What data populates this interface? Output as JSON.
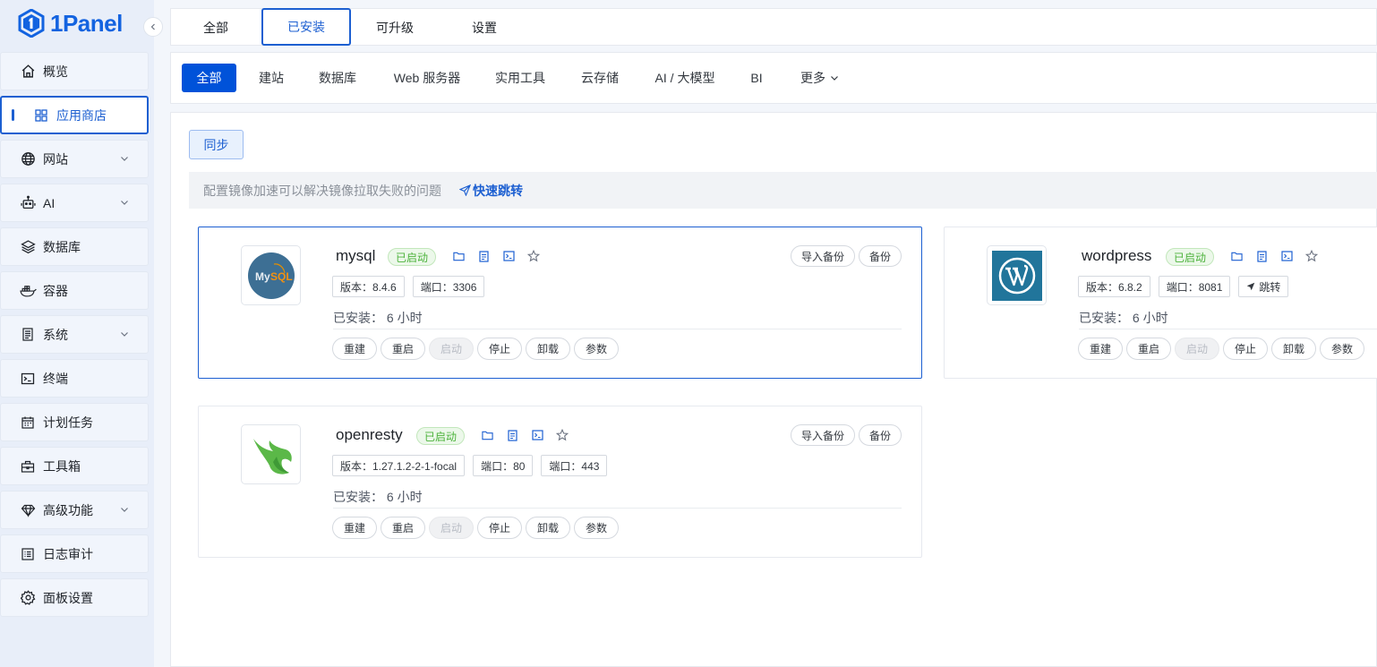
{
  "sidebar": {
    "logo_text": "1Panel",
    "items": [
      {
        "label": "概览",
        "icon": "home-icon",
        "has_children": false,
        "active": false
      },
      {
        "label": "应用商店",
        "icon": "apps-grid-icon",
        "has_children": false,
        "active": true
      },
      {
        "label": "网站",
        "icon": "globe-icon",
        "has_children": true,
        "active": false
      },
      {
        "label": "AI",
        "icon": "robot-icon",
        "has_children": true,
        "active": false
      },
      {
        "label": "数据库",
        "icon": "layers-icon",
        "has_children": false,
        "active": false
      },
      {
        "label": "容器",
        "icon": "docker-icon",
        "has_children": false,
        "active": false
      },
      {
        "label": "系统",
        "icon": "server-icon",
        "has_children": true,
        "active": false
      },
      {
        "label": "终端",
        "icon": "terminal-icon",
        "has_children": false,
        "active": false
      },
      {
        "label": "计划任务",
        "icon": "calendar-icon",
        "has_children": false,
        "active": false
      },
      {
        "label": "工具箱",
        "icon": "toolbox-icon",
        "has_children": false,
        "active": false
      },
      {
        "label": "高级功能",
        "icon": "diamond-icon",
        "has_children": true,
        "active": false
      },
      {
        "label": "日志审计",
        "icon": "log-icon",
        "has_children": false,
        "active": false
      },
      {
        "label": "面板设置",
        "icon": "gear-icon",
        "has_children": false,
        "active": false
      }
    ]
  },
  "top_tabs": [
    {
      "label": "全部",
      "active": false
    },
    {
      "label": "已安装",
      "active": true
    },
    {
      "label": "可升级",
      "active": false
    },
    {
      "label": "设置",
      "active": false
    }
  ],
  "categories": [
    {
      "label": "全部",
      "active": true
    },
    {
      "label": "建站",
      "active": false
    },
    {
      "label": "数据库",
      "active": false
    },
    {
      "label": "Web 服务器",
      "active": false
    },
    {
      "label": "实用工具",
      "active": false
    },
    {
      "label": "云存储",
      "active": false
    },
    {
      "label": "AI / 大模型",
      "active": false
    },
    {
      "label": "BI",
      "active": false
    },
    {
      "label": "更多",
      "active": false
    }
  ],
  "sync_label": "同步",
  "notice": {
    "text": "配置镜像加速可以解决镜像拉取失败的问题",
    "link": "快速跳转"
  },
  "apps": [
    {
      "name": "mysql",
      "status": "已启动",
      "version": "版本：8.4.6",
      "port": "端口：3306",
      "installed": "已安装：  6 小时",
      "import_backup": "导入备份",
      "backup": "备份",
      "ops": [
        "重建",
        "重启",
        "启动",
        "停止",
        "卸载",
        "参数"
      ]
    },
    {
      "name": "wordpress",
      "status": "已启动",
      "version": "版本：6.8.2",
      "port": "端口：8081",
      "jump": "跳转",
      "installed": "已安装：  6 小时",
      "ops": [
        "重建",
        "重启",
        "启动",
        "停止",
        "卸载",
        "参数"
      ]
    },
    {
      "name": "openresty",
      "status": "已启动",
      "version": "版本：1.27.1.2-2-1-focal",
      "port": "端口：80",
      "port2": "端口：443",
      "installed": "已安装：  6 小时",
      "import_backup": "导入备份",
      "backup": "备份",
      "ops": [
        "重建",
        "重启",
        "启动",
        "停止",
        "卸载",
        "参数"
      ]
    }
  ],
  "colors": {
    "primary": "#1c5fd1",
    "success": "#4bb23a",
    "sidebar_bg": "#e8eef9"
  }
}
